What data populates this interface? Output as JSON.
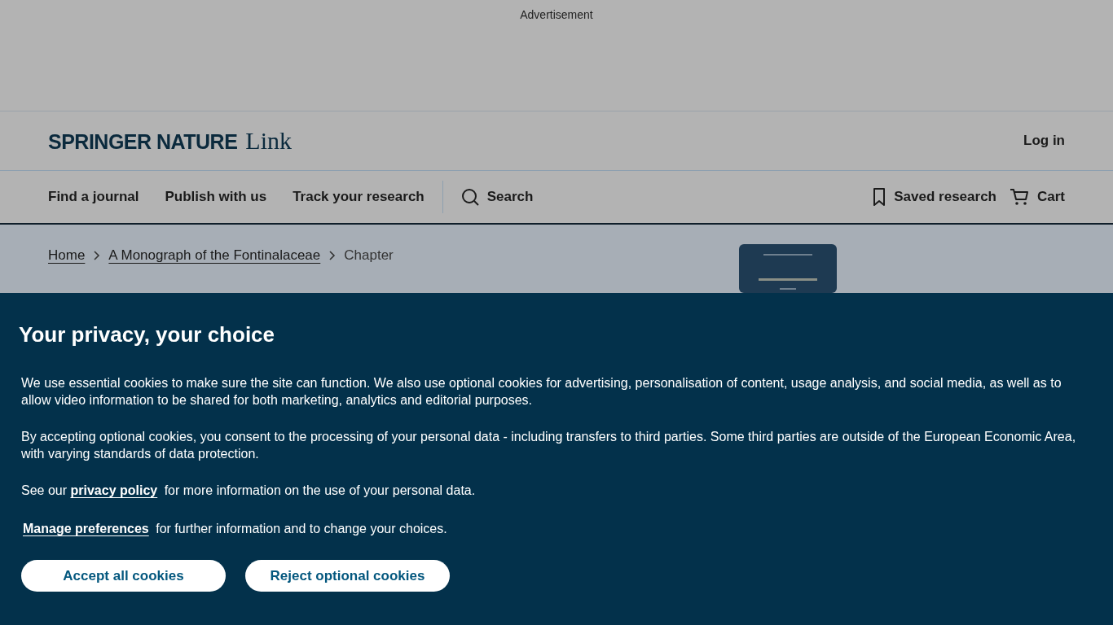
{
  "advertisement": {
    "label": "Advertisement"
  },
  "header": {
    "logo": {
      "brand": "SPRINGER NATURE",
      "product": "Link"
    },
    "login": "Log in"
  },
  "nav": {
    "items": [
      {
        "label": "Find a journal"
      },
      {
        "label": "Publish with us"
      },
      {
        "label": "Track your research"
      }
    ],
    "search": "Search",
    "saved": "Saved research",
    "cart": "Cart"
  },
  "breadcrumb": {
    "items": [
      {
        "label": "Home",
        "kind": "link"
      },
      {
        "label": "A Monograph of the Fontinalaceae",
        "kind": "link"
      },
      {
        "label": "Chapter",
        "kind": "current"
      }
    ]
  },
  "cookie_banner": {
    "title": "Your privacy, your choice",
    "paragraphs": [
      {
        "before": "We use essential cookies to make sure the site can function. We also use optional cookies for advertising, personalisation of content, usage analysis, and social media, as well as to allow video information to be shared for both marketing, analytics and editorial purposes."
      },
      {
        "before": "By accepting optional cookies, you consent to the processing of your personal data - including transfers to third parties. Some third parties are outside of the European Economic Area, with varying standards of data protection."
      },
      {
        "before": "See our ",
        "link": "privacy policy",
        "after": " for more information on the use of your personal data."
      },
      {
        "link": "Manage preferences",
        "after": " for further information and to change your choices.",
        "kind": "manage"
      }
    ],
    "buttons": [
      "Accept all cookies",
      "Reject optional cookies"
    ]
  }
}
